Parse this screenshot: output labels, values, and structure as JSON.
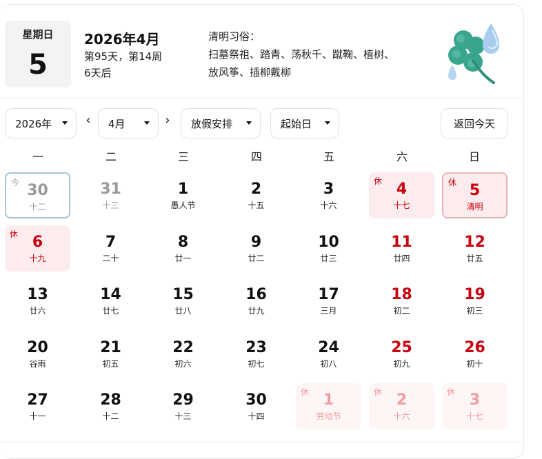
{
  "header": {
    "weekday_label": "星期日",
    "weekday_day": "5",
    "date_title": "2026年4月",
    "day_info": "第95天，第14周",
    "relative": "6天后",
    "custom_title": "清明习俗：",
    "custom_text": "扫墓祭祖、踏青、荡秋千、蹴鞠、植树、放风筝、插柳戴柳"
  },
  "controls": {
    "year": "2026年",
    "month": "4月",
    "holiday": "放假安排",
    "start_day": "起始日",
    "today_button": "返回今天",
    "prev_arrow": "‹",
    "next_arrow": "›"
  },
  "weekdays": [
    "一",
    "二",
    "三",
    "四",
    "五",
    "六",
    "日"
  ],
  "weeks": [
    [
      {
        "d": "30",
        "s": "十二",
        "style": "grey",
        "tag": "今",
        "today": true
      },
      {
        "d": "31",
        "s": "十三",
        "style": "grey"
      },
      {
        "d": "1",
        "s": "愚人节",
        "style": "black"
      },
      {
        "d": "2",
        "s": "十五",
        "style": "black"
      },
      {
        "d": "3",
        "s": "十六",
        "style": "black"
      },
      {
        "d": "4",
        "s": "十七",
        "style": "holiday",
        "tag": "休"
      },
      {
        "d": "5",
        "s": "清明",
        "style": "holiday",
        "tag": "休",
        "selected": true
      }
    ],
    [
      {
        "d": "6",
        "s": "十九",
        "style": "holiday",
        "tag": "休"
      },
      {
        "d": "7",
        "s": "二十",
        "style": "black"
      },
      {
        "d": "8",
        "s": "廿一",
        "style": "black"
      },
      {
        "d": "9",
        "s": "廿二",
        "style": "black"
      },
      {
        "d": "10",
        "s": "廿三",
        "style": "black"
      },
      {
        "d": "11",
        "s": "廿四",
        "style": "red"
      },
      {
        "d": "12",
        "s": "廿五",
        "style": "red"
      }
    ],
    [
      {
        "d": "13",
        "s": "廿六",
        "style": "black"
      },
      {
        "d": "14",
        "s": "廿七",
        "style": "black"
      },
      {
        "d": "15",
        "s": "廿八",
        "style": "black"
      },
      {
        "d": "16",
        "s": "廿九",
        "style": "black"
      },
      {
        "d": "17",
        "s": "三月",
        "style": "black"
      },
      {
        "d": "18",
        "s": "初二",
        "style": "red"
      },
      {
        "d": "19",
        "s": "初三",
        "style": "red"
      }
    ],
    [
      {
        "d": "20",
        "s": "谷雨",
        "style": "black"
      },
      {
        "d": "21",
        "s": "初五",
        "style": "black"
      },
      {
        "d": "22",
        "s": "初六",
        "style": "black"
      },
      {
        "d": "23",
        "s": "初七",
        "style": "black"
      },
      {
        "d": "24",
        "s": "初八",
        "style": "black"
      },
      {
        "d": "25",
        "s": "初九",
        "style": "red"
      },
      {
        "d": "26",
        "s": "初十",
        "style": "red"
      }
    ],
    [
      {
        "d": "27",
        "s": "十一",
        "style": "black"
      },
      {
        "d": "28",
        "s": "十二",
        "style": "black"
      },
      {
        "d": "29",
        "s": "十三",
        "style": "black"
      },
      {
        "d": "30",
        "s": "十四",
        "style": "black"
      },
      {
        "d": "1",
        "s": "劳动节",
        "style": "holiday-faded",
        "tag": "休"
      },
      {
        "d": "2",
        "s": "十六",
        "style": "holiday-faded",
        "tag": "休"
      },
      {
        "d": "3",
        "s": "十七",
        "style": "holiday-faded",
        "tag": "休"
      }
    ]
  ],
  "colors": {
    "holiday_red": "#c8000f",
    "holiday_bg": "#fdeced",
    "today_border": "#a8c2d6",
    "clover_green": "#3aa58f",
    "droplet_blue": "#a9cdee"
  },
  "icons": {
    "clover": "clover-droplet-icon",
    "dropdown": "caret-down-icon"
  }
}
